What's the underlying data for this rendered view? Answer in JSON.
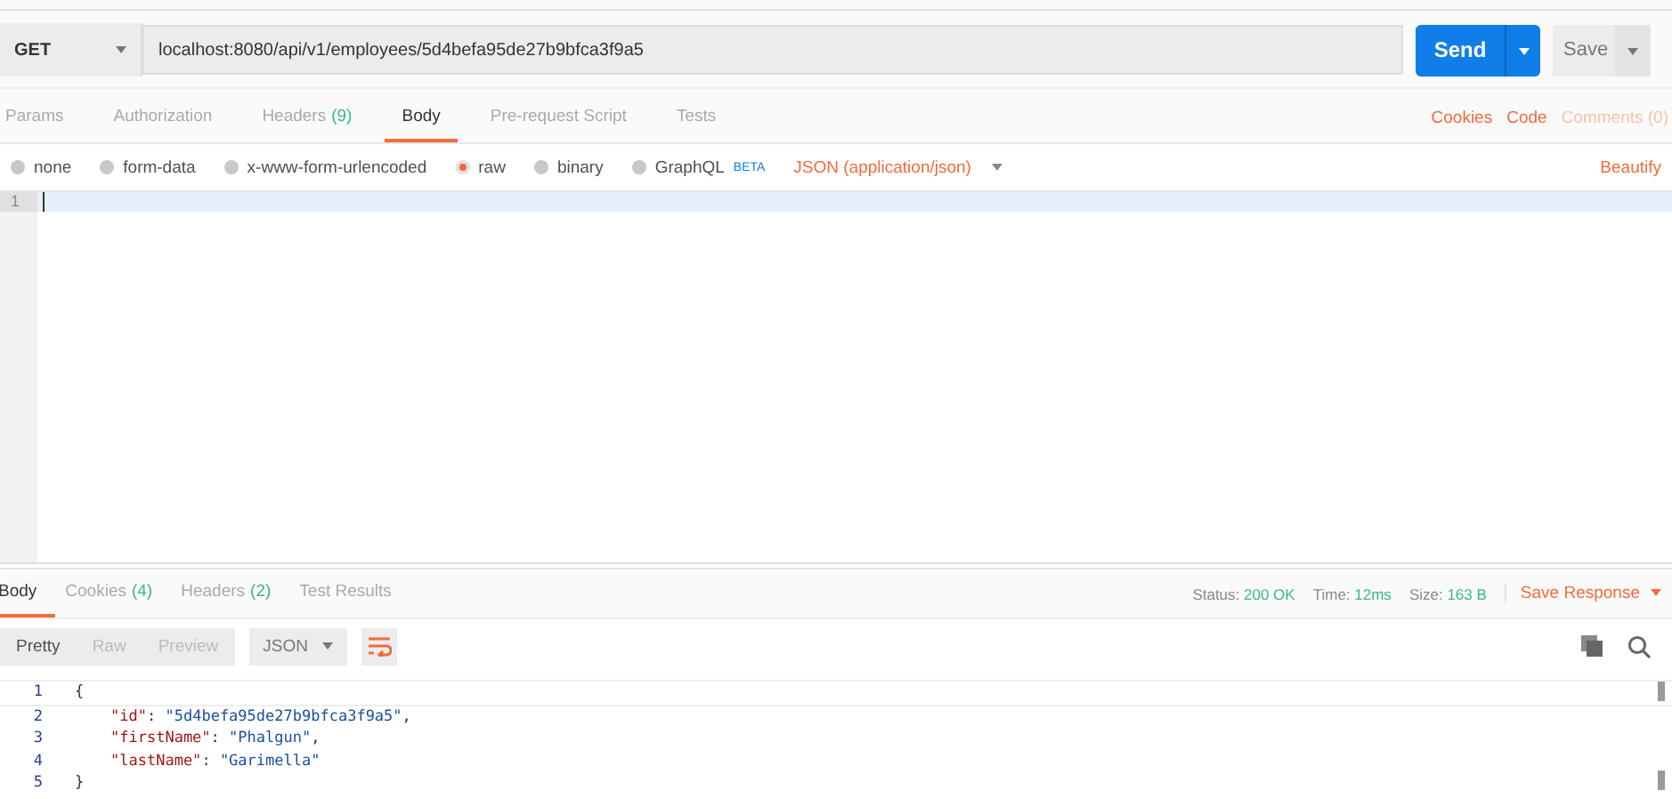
{
  "request": {
    "method": "GET",
    "url": "localhost:8080/api/v1/employees/5d4befa95de27b9bfca3f9a5",
    "send": "Send",
    "save": "Save"
  },
  "request_tabs": [
    {
      "label": "Params",
      "selected": false
    },
    {
      "label": "Authorization",
      "selected": false
    },
    {
      "label": "Headers",
      "count": "(9)",
      "selected": false
    },
    {
      "label": "Body",
      "selected": true
    },
    {
      "label": "Pre-request Script",
      "selected": false
    },
    {
      "label": "Tests",
      "selected": false
    }
  ],
  "request_links": [
    {
      "label": "Cookies",
      "disabled": false
    },
    {
      "label": "Code",
      "disabled": false
    },
    {
      "label": "Comments (0)",
      "disabled": true
    }
  ],
  "body_types": [
    {
      "label": "none",
      "selected": false
    },
    {
      "label": "form-data",
      "selected": false
    },
    {
      "label": "x-www-form-urlencoded",
      "selected": false
    },
    {
      "label": "raw",
      "selected": true
    },
    {
      "label": "binary",
      "selected": false
    },
    {
      "label": "GraphQL",
      "badge": "BETA",
      "selected": false
    }
  ],
  "content_type": "JSON (application/json)",
  "beautify": "Beautify",
  "editor": {
    "line_numbers": [
      "1"
    ]
  },
  "response_tabs": [
    {
      "label": "Body",
      "selected": true
    },
    {
      "label": "Cookies",
      "count": "(4)",
      "selected": false
    },
    {
      "label": "Headers",
      "count": "(2)",
      "selected": false
    },
    {
      "label": "Test Results",
      "selected": false
    }
  ],
  "response_meta": [
    {
      "label": "Status:",
      "value": "200 OK"
    },
    {
      "label": "Time:",
      "value": "12ms"
    },
    {
      "label": "Size:",
      "value": "163 B"
    }
  ],
  "save_response": "Save Response",
  "view_modes": [
    {
      "label": "Pretty",
      "selected": true
    },
    {
      "label": "Raw",
      "selected": false
    },
    {
      "label": "Preview",
      "selected": false
    }
  ],
  "format": "JSON",
  "response_lines": [
    {
      "number": "1",
      "tokens": [
        {
          "kind": "punct",
          "text": "{"
        }
      ]
    },
    {
      "number": "2",
      "tokens": [
        {
          "kind": "key",
          "text": "\"id\""
        },
        {
          "kind": "punct",
          "text": ": "
        },
        {
          "kind": "string",
          "text": "\"5d4befa95de27b9bfca3f9a5\""
        },
        {
          "kind": "punct",
          "text": ","
        }
      ]
    },
    {
      "number": "3",
      "tokens": [
        {
          "kind": "key",
          "text": "\"firstName\""
        },
        {
          "kind": "punct",
          "text": ": "
        },
        {
          "kind": "string",
          "text": "\"Phalgun\""
        },
        {
          "kind": "punct",
          "text": ","
        }
      ]
    },
    {
      "number": "4",
      "tokens": [
        {
          "kind": "key",
          "text": "\"lastName\""
        },
        {
          "kind": "punct",
          "text": ": "
        },
        {
          "kind": "string",
          "text": "\"Garimella\""
        }
      ]
    },
    {
      "number": "5",
      "tokens": [
        {
          "kind": "punct",
          "text": "}"
        }
      ]
    }
  ]
}
